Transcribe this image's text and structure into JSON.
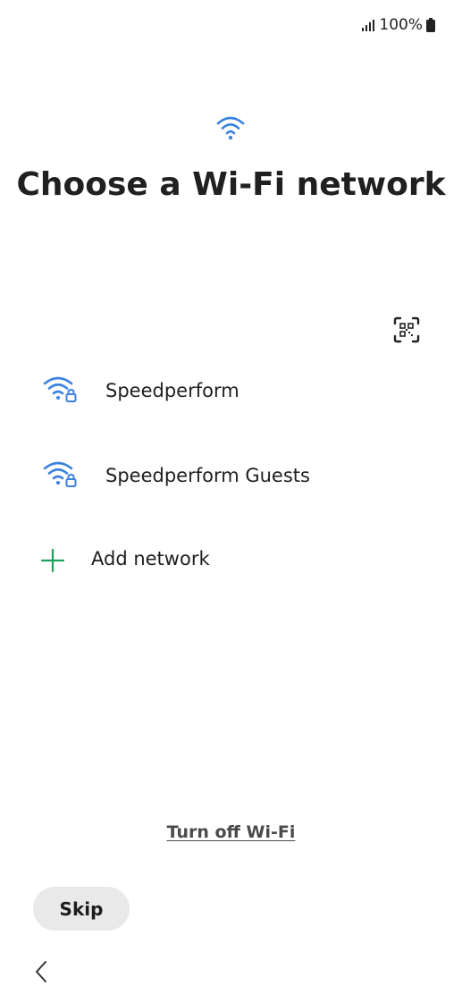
{
  "status_bar": {
    "signal_icon": "signal-bars-icon",
    "battery_text": "100%",
    "battery_icon": "battery-icon"
  },
  "header": {
    "icon": "wifi-icon",
    "title": "Choose a Wi-Fi network"
  },
  "qr_button": {
    "icon": "qr-code-scan-icon"
  },
  "networks": [
    {
      "name": "Speedperform",
      "icon": "wifi-lock-icon"
    },
    {
      "name": "Speedperform Guests",
      "icon": "wifi-lock-icon"
    }
  ],
  "add_network": {
    "label": "Add network",
    "icon": "plus-icon"
  },
  "footer": {
    "turn_off_label": "Turn off Wi-Fi",
    "skip_label": "Skip",
    "back_icon": "chevron-left-icon"
  },
  "colors": {
    "accent_blue": "#3b82e0",
    "add_green": "#1aa35a",
    "skip_bg": "#e9e9e9"
  }
}
